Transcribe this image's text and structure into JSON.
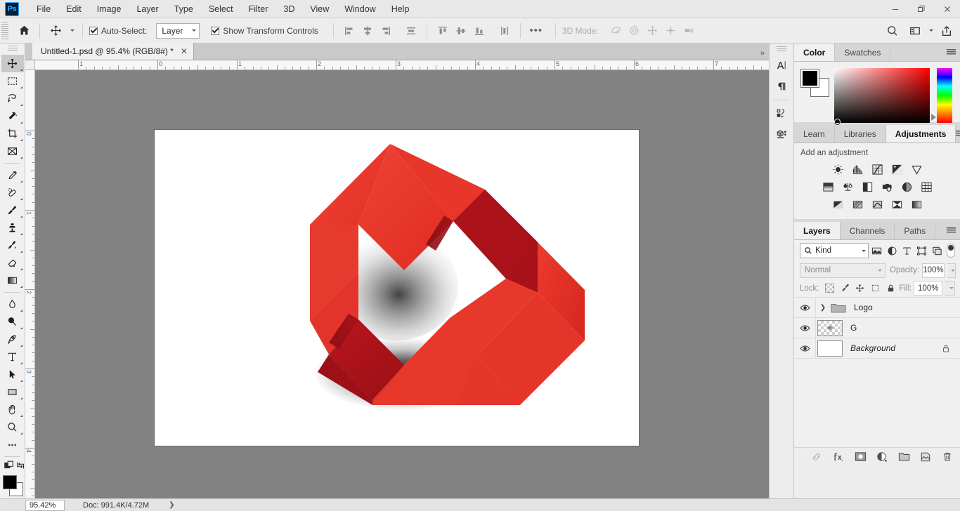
{
  "app": {
    "name": "Ps",
    "window_controls": {
      "minimize": "—",
      "restore": "❐",
      "close": "✕"
    }
  },
  "menubar": {
    "items": [
      "File",
      "Edit",
      "Image",
      "Layer",
      "Type",
      "Select",
      "Filter",
      "3D",
      "View",
      "Window",
      "Help"
    ]
  },
  "options_bar": {
    "home_icon": "home-icon",
    "active_tool_icon": "move-tool-icon",
    "auto_select": {
      "label": "Auto-Select:",
      "checked": true
    },
    "auto_select_scope": "Layer",
    "show_transform": {
      "label": "Show Transform Controls",
      "checked": true
    },
    "align_icons": [
      "align-left-edges-icon",
      "align-horizontal-centers-icon",
      "align-right-edges-icon",
      "distribute-horizontal-icon",
      "align-top-edges-icon",
      "align-vertical-centers-icon",
      "align-bottom-edges-icon",
      "distribute-vertical-icon"
    ],
    "more_label": "•••",
    "mode_3d_label": "3D Mode:",
    "mode_3d_icons": [
      "orbit-3d-icon",
      "roll-3d-icon",
      "pan-3d-icon",
      "slide-3d-icon",
      "camera-3d-icon"
    ],
    "right_icons": [
      "search-icon",
      "workspace-icon",
      "chevron-down-icon",
      "share-icon"
    ]
  },
  "toolbar": {
    "tools": [
      {
        "name": "move-tool",
        "active": true
      },
      {
        "name": "rectangular-marquee-tool",
        "active": false
      },
      {
        "name": "lasso-tool",
        "active": false
      },
      {
        "name": "magic-wand-tool",
        "active": false
      },
      {
        "name": "crop-tool",
        "active": false
      },
      {
        "name": "frame-tool",
        "active": false
      },
      {
        "name": "eyedropper-tool",
        "active": false
      },
      {
        "name": "spot-healing-brush-tool",
        "active": false
      },
      {
        "name": "brush-tool",
        "active": false
      },
      {
        "name": "clone-stamp-tool",
        "active": false
      },
      {
        "name": "history-brush-tool",
        "active": false
      },
      {
        "name": "eraser-tool",
        "active": false
      },
      {
        "name": "gradient-tool",
        "active": false
      },
      {
        "name": "blur-tool",
        "active": false
      },
      {
        "name": "dodge-tool",
        "active": false
      },
      {
        "name": "pen-tool",
        "active": false
      },
      {
        "name": "type-tool",
        "active": false
      },
      {
        "name": "path-selection-tool",
        "active": false
      },
      {
        "name": "rectangle-tool",
        "active": false
      },
      {
        "name": "hand-tool",
        "active": false
      },
      {
        "name": "zoom-tool",
        "active": false
      },
      {
        "name": "edit-toolbar-tool",
        "active": false
      }
    ],
    "foreground_color": "#000000",
    "background_color": "#ffffff"
  },
  "document": {
    "tab_title": "Untitled-1.psd @ 95.4% (RGB/8#) *",
    "close_label": "✕",
    "ruler_units_h": [
      "1",
      "0",
      "1",
      "2",
      "3",
      "4",
      "5",
      "6",
      "7"
    ],
    "ruler_units_v": [
      "0",
      "1",
      "2",
      "3",
      "4"
    ]
  },
  "artwork": {
    "name": "red-origami-ring-logo",
    "bright_red": "#e8382c",
    "dark_red": "#aa1019",
    "mid_red": "#c8202a",
    "deep_red": "#8c0d14",
    "canvas_background": "#ffffff"
  },
  "icon_dock": {
    "icons": [
      "character-panel-icon",
      "paragraph-panel-icon",
      "glyphs-panel-icon",
      "3d-panel-icon"
    ]
  },
  "color_panel": {
    "tabs": [
      {
        "label": "Color",
        "active": true
      },
      {
        "label": "Swatches",
        "active": false
      }
    ],
    "foreground": "#000000",
    "background": "#ffffff",
    "hue": "#ff0000"
  },
  "adjustments_panel": {
    "tabs": [
      {
        "label": "Learn",
        "active": false
      },
      {
        "label": "Libraries",
        "active": false
      },
      {
        "label": "Adjustments",
        "active": true
      }
    ],
    "title": "Add an adjustment",
    "rows": [
      [
        "brightness-contrast-icon",
        "levels-icon",
        "curves-icon",
        "exposure-icon",
        "vibrance-icon"
      ],
      [
        "hue-saturation-icon",
        "color-balance-icon",
        "black-white-icon",
        "photo-filter-icon",
        "channel-mixer-icon",
        "color-lookup-icon"
      ],
      [
        "invert-icon",
        "posterize-icon",
        "threshold-icon",
        "gradient-map-icon",
        "selective-color-icon"
      ]
    ]
  },
  "layers_panel": {
    "tabs": [
      {
        "label": "Layers",
        "active": true
      },
      {
        "label": "Channels",
        "active": false
      },
      {
        "label": "Paths",
        "active": false
      }
    ],
    "filter": {
      "kind_label": "Kind",
      "icons": [
        "filter-pixel-icon",
        "filter-adjustment-icon",
        "filter-type-icon",
        "filter-shape-icon",
        "filter-smart-object-icon"
      ],
      "toggle": "filter-enable-toggle"
    },
    "blend_mode": "Normal",
    "opacity_label": "Opacity:",
    "opacity_value": "100%",
    "lock_label": "Lock:",
    "lock_icons": [
      "lock-transparency-icon",
      "lock-image-icon",
      "lock-position-icon",
      "lock-artboard-icon",
      "lock-all-icon"
    ],
    "fill_label": "Fill:",
    "fill_value": "100%",
    "layers": [
      {
        "name": "Logo",
        "type": "group",
        "visible": true,
        "locked": false,
        "italic": false
      },
      {
        "name": "G",
        "type": "pixel",
        "visible": true,
        "locked": false,
        "italic": false
      },
      {
        "name": "Background",
        "type": "background",
        "visible": true,
        "locked": true,
        "italic": true
      }
    ],
    "footer_icons": [
      "link-layers-icon",
      "layer-style-fx-icon",
      "add-layer-mask-icon",
      "new-adjustment-layer-icon",
      "new-group-icon",
      "new-layer-icon",
      "delete-layer-icon"
    ]
  },
  "status_bar": {
    "zoom": "95.42%",
    "doc_info": "Doc: 991.4K/4.72M",
    "expand_arrow": "❯"
  }
}
